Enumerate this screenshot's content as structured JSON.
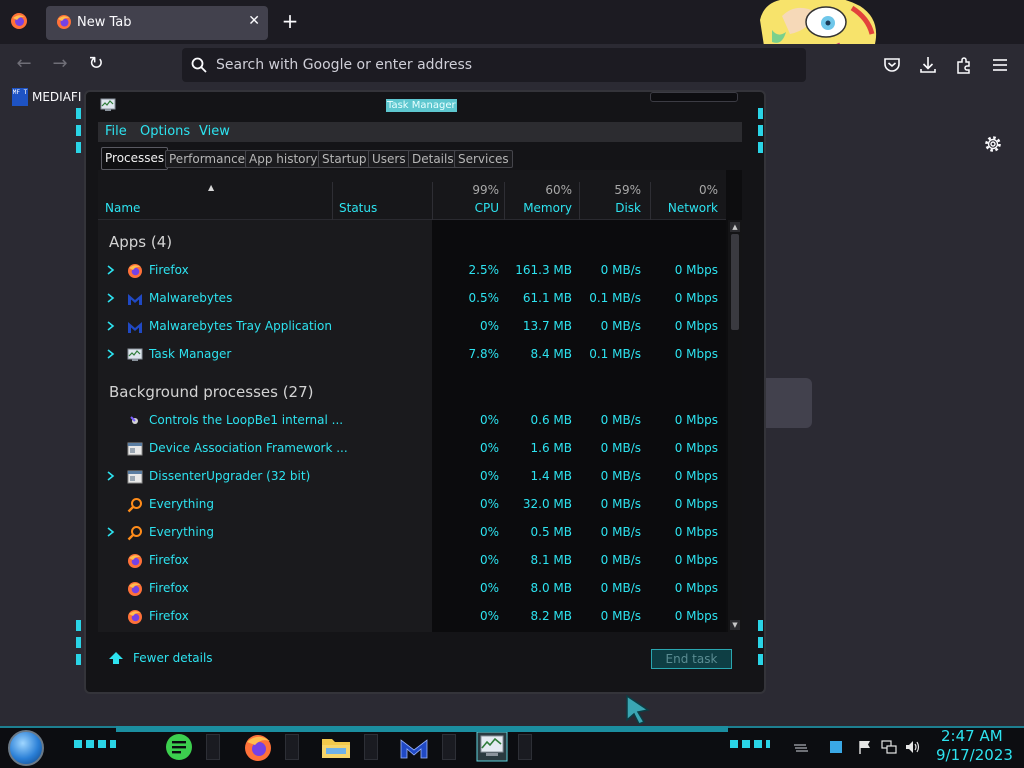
{
  "browser": {
    "tab": {
      "title": "New Tab",
      "close": "✕"
    },
    "new_tab": "+",
    "url_placeholder": "Search with Google or enter address",
    "nav": {
      "back": "←",
      "forward": "→",
      "reload": "↻"
    },
    "bookmark": {
      "icon_text": "MF T",
      "label": "MEDIAFI"
    }
  },
  "task_manager": {
    "title": "Task Manager",
    "menu": [
      "File",
      "Options",
      "View"
    ],
    "tabs": [
      "Processes",
      "Performance",
      "App history",
      "Startup",
      "Users",
      "Details",
      "Services"
    ],
    "active_tab": "Processes",
    "columns": {
      "name": "Name",
      "status": "Status",
      "cpu": {
        "pct": "99%",
        "label": "CPU"
      },
      "memory": {
        "pct": "60%",
        "label": "Memory"
      },
      "disk": {
        "pct": "59%",
        "label": "Disk"
      },
      "network": {
        "pct": "0%",
        "label": "Network"
      }
    },
    "groups": {
      "apps": "Apps (4)",
      "background": "Background processes (27)"
    },
    "apps": [
      {
        "name": "Firefox",
        "icon": "firefox-icon",
        "expand": true,
        "cpu": "2.5%",
        "memory": "161.3 MB",
        "disk": "0 MB/s",
        "network": "0 Mbps"
      },
      {
        "name": "Malwarebytes",
        "icon": "malwarebytes-icon",
        "expand": true,
        "cpu": "0.5%",
        "memory": "61.1 MB",
        "disk": "0.1 MB/s",
        "network": "0 Mbps"
      },
      {
        "name": "Malwarebytes Tray Application",
        "icon": "malwarebytes-icon",
        "expand": true,
        "cpu": "0%",
        "memory": "13.7 MB",
        "disk": "0 MB/s",
        "network": "0 Mbps"
      },
      {
        "name": "Task Manager",
        "icon": "task-manager-icon",
        "expand": true,
        "cpu": "7.8%",
        "memory": "8.4 MB",
        "disk": "0.1 MB/s",
        "network": "0 Mbps"
      }
    ],
    "background": [
      {
        "name": "Controls the LoopBe1 internal ...",
        "icon": "loopbe-icon",
        "expand": false,
        "cpu": "0%",
        "memory": "0.6 MB",
        "disk": "0 MB/s",
        "network": "0 Mbps"
      },
      {
        "name": "Device Association Framework ...",
        "icon": "window-app-icon",
        "expand": false,
        "cpu": "0%",
        "memory": "1.6 MB",
        "disk": "0 MB/s",
        "network": "0 Mbps"
      },
      {
        "name": "DissenterUpgrader (32 bit)",
        "icon": "window-app-icon",
        "expand": true,
        "cpu": "0%",
        "memory": "1.4 MB",
        "disk": "0 MB/s",
        "network": "0 Mbps"
      },
      {
        "name": "Everything",
        "icon": "everything-search-icon",
        "expand": false,
        "cpu": "0%",
        "memory": "32.0 MB",
        "disk": "0 MB/s",
        "network": "0 Mbps"
      },
      {
        "name": "Everything",
        "icon": "everything-search-icon",
        "expand": true,
        "cpu": "0%",
        "memory": "0.5 MB",
        "disk": "0 MB/s",
        "network": "0 Mbps"
      },
      {
        "name": "Firefox",
        "icon": "firefox-icon",
        "expand": false,
        "cpu": "0%",
        "memory": "8.1 MB",
        "disk": "0 MB/s",
        "network": "0 Mbps"
      },
      {
        "name": "Firefox",
        "icon": "firefox-icon",
        "expand": false,
        "cpu": "0%",
        "memory": "8.0 MB",
        "disk": "0 MB/s",
        "network": "0 Mbps"
      },
      {
        "name": "Firefox",
        "icon": "firefox-icon",
        "expand": false,
        "cpu": "0%",
        "memory": "8.2 MB",
        "disk": "0 MB/s",
        "network": "0 Mbps"
      }
    ],
    "footer": {
      "fewer_details": "Fewer details",
      "end_task": "End task"
    }
  },
  "taskbar": {
    "apps": [
      "notes-app-icon",
      "firefox-icon",
      "file-explorer-icon",
      "malwarebytes-icon",
      "task-manager-icon"
    ],
    "clock": {
      "time": "2:47 AM",
      "date": "9/17/2023"
    }
  },
  "colors": {
    "accent_cyan": "#2de3f0",
    "firefox_orange": "#ff7139",
    "malwarebytes_blue": "#2049c4",
    "taskbar_neon": "#1b8ea0"
  }
}
